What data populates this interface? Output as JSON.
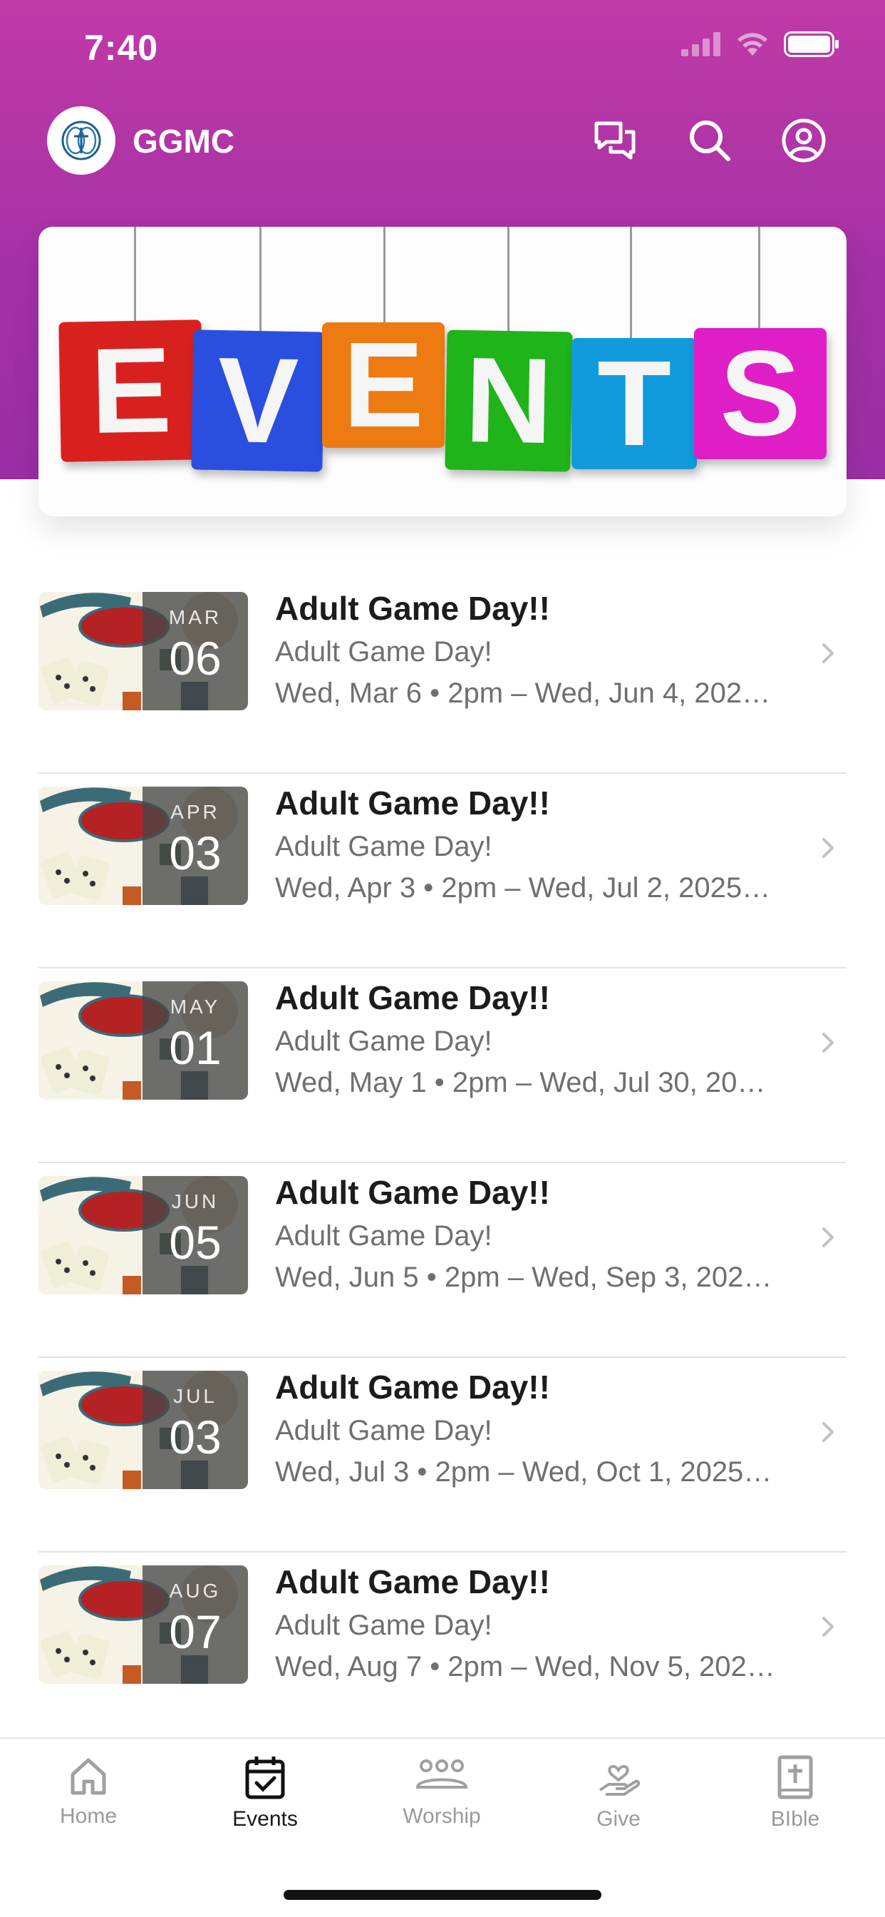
{
  "status_bar": {
    "time": "7:40"
  },
  "header": {
    "app_name": "GGMC",
    "icons": [
      "chat-icon",
      "search-icon",
      "profile-icon"
    ]
  },
  "banner": {
    "letters": [
      "E",
      "V",
      "E",
      "N",
      "T",
      "S"
    ],
    "colors": [
      "#d8211f",
      "#2a4ee0",
      "#ee7a12",
      "#1eb41a",
      "#119bdc",
      "#e01ec7"
    ]
  },
  "events": [
    {
      "title": "Adult Game Day!!",
      "subtitle": "Adult Game Day!",
      "month": "MAR",
      "day": "06",
      "when": "Wed, Mar 6 • 2pm – Wed, Jun 4, 202…"
    },
    {
      "title": "Adult Game Day!!",
      "subtitle": "Adult Game Day!",
      "month": "APR",
      "day": "03",
      "when": "Wed, Apr 3 • 2pm – Wed, Jul 2, 2025…"
    },
    {
      "title": "Adult Game Day!!",
      "subtitle": "Adult Game Day!",
      "month": "MAY",
      "day": "01",
      "when": "Wed, May 1 • 2pm – Wed, Jul 30, 20…"
    },
    {
      "title": "Adult Game Day!!",
      "subtitle": "Adult Game Day!",
      "month": "JUN",
      "day": "05",
      "when": "Wed, Jun 5 • 2pm – Wed, Sep 3, 202…"
    },
    {
      "title": "Adult Game Day!!",
      "subtitle": "Adult Game Day!",
      "month": "JUL",
      "day": "03",
      "when": "Wed, Jul 3 • 2pm – Wed, Oct 1, 2025…"
    },
    {
      "title": "Adult Game Day!!",
      "subtitle": "Adult Game Day!",
      "month": "AUG",
      "day": "07",
      "when": "Wed, Aug 7 • 2pm – Wed, Nov 5, 202…"
    }
  ],
  "tabs": [
    {
      "label": "Home",
      "icon": "home-icon",
      "active": false
    },
    {
      "label": "Events",
      "icon": "calendar-icon",
      "active": true
    },
    {
      "label": "Worship",
      "icon": "people-icon",
      "active": false
    },
    {
      "label": "Give",
      "icon": "give-hand-icon",
      "active": false
    },
    {
      "label": "BIble",
      "icon": "bible-icon",
      "active": false
    }
  ],
  "theme": {
    "header_gradient_top": "#c13aa7",
    "header_gradient_bottom": "#9a2ea4"
  }
}
